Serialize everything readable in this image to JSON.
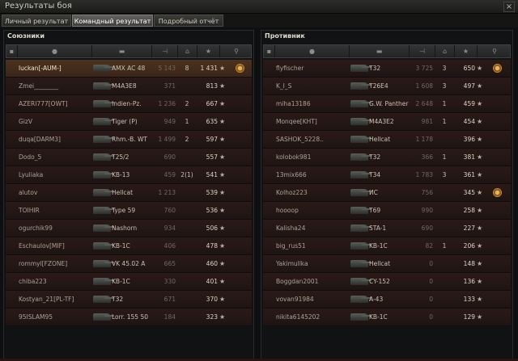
{
  "window": {
    "title": "Результаты боя",
    "close": "×"
  },
  "tabs": [
    {
      "label": "Личный результат",
      "active": false
    },
    {
      "label": "Командный результат",
      "active": true
    },
    {
      "label": "Подробный отчёт",
      "active": false
    }
  ],
  "allies": {
    "title": "Союзники",
    "rows": [
      {
        "name": "luckan[-AUM-]",
        "tank": "AMX AC 48",
        "damage": "5 143",
        "kills": "8",
        "xp": "1 431",
        "highlight": true,
        "medal": true
      },
      {
        "name": "Zmei________",
        "tank": "M4A3E8",
        "damage": "371",
        "kills": "",
        "xp": "813"
      },
      {
        "name": "AZERI777[OWT]",
        "tank": "Indien-Pz.",
        "damage": "1 236",
        "kills": "2",
        "xp": "667"
      },
      {
        "name": "GizV",
        "tank": "Tiger (P)",
        "damage": "949",
        "kills": "1",
        "xp": "635"
      },
      {
        "name": "duqa[DARM3]",
        "tank": "Rhm.-B. WT",
        "damage": "1 499",
        "kills": "2",
        "xp": "597"
      },
      {
        "name": "Dodo_5",
        "tank": "T25/2",
        "damage": "690",
        "kills": "",
        "xp": "557"
      },
      {
        "name": "Lyuliaka",
        "tank": "KB-13",
        "damage": "459",
        "kills": "2(1)",
        "xp": "541"
      },
      {
        "name": "alutov",
        "tank": "Hellcat",
        "damage": "1 213",
        "kills": "",
        "xp": "539"
      },
      {
        "name": "TOIHIR",
        "tank": "Type 59",
        "damage": "760",
        "kills": "",
        "xp": "536"
      },
      {
        "name": "ogurchik99",
        "tank": "Nashorn",
        "damage": "934",
        "kills": "",
        "xp": "506"
      },
      {
        "name": "Eschaulov[MIF]",
        "tank": "KB-1C",
        "damage": "406",
        "kills": "",
        "xp": "478"
      },
      {
        "name": "rommyl[FZONE]",
        "tank": "VK 45.02 A",
        "damage": "665",
        "kills": "",
        "xp": "460"
      },
      {
        "name": "chiba223",
        "tank": "KB-1C",
        "damage": "330",
        "kills": "",
        "xp": "401"
      },
      {
        "name": "Kostyan_21[PL-TF]",
        "tank": "T32",
        "damage": "671",
        "kills": "",
        "xp": "370"
      },
      {
        "name": "95ISLAM95",
        "tank": "Lorr. 155 50",
        "damage": "184",
        "kills": "",
        "xp": "323"
      }
    ]
  },
  "enemies": {
    "title": "Противник",
    "rows": [
      {
        "name": "flyfischer",
        "tank": "T32",
        "damage": "3 725",
        "kills": "3",
        "xp": "650",
        "medal": true
      },
      {
        "name": "K_I_S",
        "tank": "T26E4",
        "damage": "1 608",
        "kills": "3",
        "xp": "497"
      },
      {
        "name": "miha13186",
        "tank": "G.W. Panther",
        "damage": "2 648",
        "kills": "1",
        "xp": "459"
      },
      {
        "name": "Monqee[KHT]",
        "tank": "M4A3E2",
        "damage": "981",
        "kills": "1",
        "xp": "454"
      },
      {
        "name": "SASHOK_5228..",
        "tank": "Hellcat",
        "damage": "1 178",
        "kills": "",
        "xp": "396"
      },
      {
        "name": "kolobok981",
        "tank": "T32",
        "damage": "366",
        "kills": "1",
        "xp": "381"
      },
      {
        "name": "13mix666",
        "tank": "T34",
        "damage": "1 783",
        "kills": "3",
        "xp": "361"
      },
      {
        "name": "Kolhoz223",
        "tank": "ИС",
        "damage": "756",
        "kills": "",
        "xp": "345",
        "medal": true
      },
      {
        "name": "hoooop",
        "tank": "T69",
        "damage": "990",
        "kills": "",
        "xp": "258"
      },
      {
        "name": "Kalisha24",
        "tank": "STA-1",
        "damage": "690",
        "kills": "",
        "xp": "227"
      },
      {
        "name": "big_rus51",
        "tank": "KB-1C",
        "damage": "82",
        "kills": "1",
        "xp": "206"
      },
      {
        "name": "Yakimullka",
        "tank": "Hellcat",
        "damage": "0",
        "kills": "",
        "xp": "148"
      },
      {
        "name": "Boggdan2001",
        "tank": "CY-152",
        "damage": "0",
        "kills": "",
        "xp": "136"
      },
      {
        "name": "vovan91984",
        "tank": "A-43",
        "damage": "0",
        "kills": "",
        "xp": "133"
      },
      {
        "name": "nikita6145202",
        "tank": "KB-1C",
        "damage": "0",
        "kills": "",
        "xp": "129"
      }
    ]
  },
  "icons": {
    "star": "★",
    "player": "player-icon",
    "tank": "tank-icon",
    "kills": "kills-icon",
    "damage": "damage-icon",
    "xp": "xp-icon",
    "platoon": "platoon-icon"
  }
}
